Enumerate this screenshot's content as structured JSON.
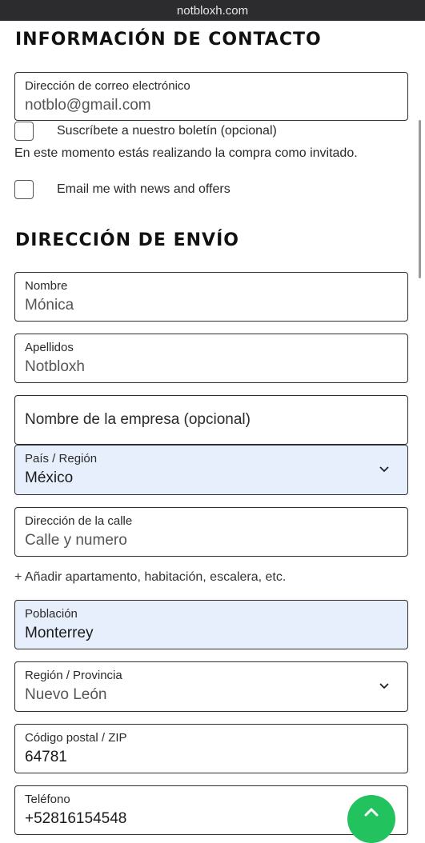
{
  "browser": {
    "url": "notbloxh.com"
  },
  "contact": {
    "heading": "INFORMACIÓN DE CONTACTO",
    "email": {
      "label": "Dirección de correo electrónico",
      "value": "notblo@gmail.com"
    },
    "newsletter_label": "Suscríbete a nuestro boletín (opcional)",
    "guest_notice": "En este momento estás realizando la compra como invitado.",
    "news_offers_label": "Email me with news and offers"
  },
  "shipping": {
    "heading": "DIRECCIÓN DE ENVÍO",
    "first_name": {
      "label": "Nombre",
      "value": "Mónica"
    },
    "last_name": {
      "label": "Apellidos",
      "value": "Notbloxh"
    },
    "company": {
      "placeholder": "Nombre de la empresa (opcional)"
    },
    "country": {
      "label": "País / Región",
      "value": "México"
    },
    "street": {
      "label": "Dirección de la calle",
      "value": "Calle y numero"
    },
    "add_apartment": "+ Añadir apartamento, habitación, escalera, etc.",
    "city": {
      "label": "Población",
      "value": "Monterrey"
    },
    "state": {
      "label": "Región / Provincia",
      "value": "Nuevo León"
    },
    "postal": {
      "label": "Código postal / ZIP",
      "value": "64781"
    },
    "phone": {
      "label": "Teléfono",
      "value": "+52816154548"
    }
  },
  "colors": {
    "accent_fab": "#22c35e",
    "autofill_bg": "#e8effc",
    "topbar_bg": "#2c2c2e"
  },
  "icons": {
    "select_arrow": "chevron-down-icon",
    "fab": "chevron-up-icon"
  }
}
